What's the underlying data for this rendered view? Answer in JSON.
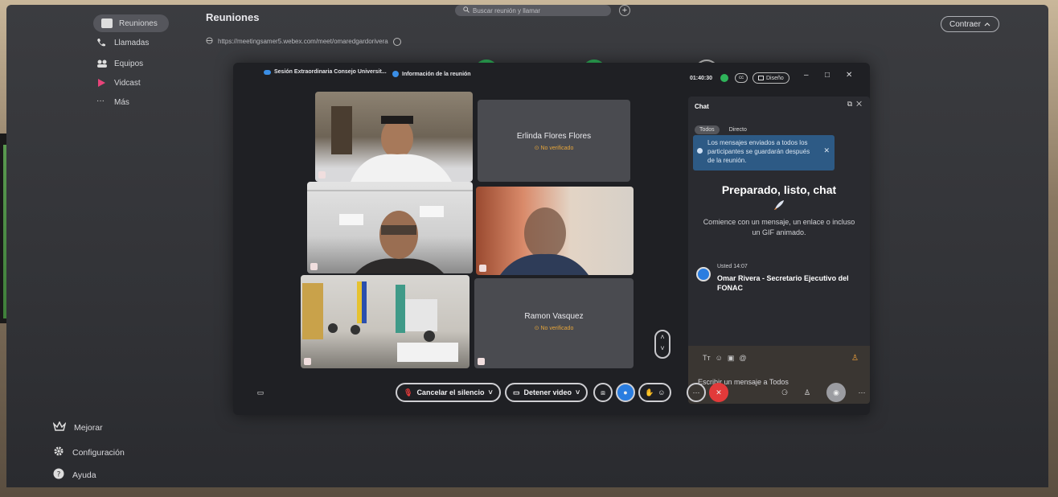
{
  "sidebar": {
    "items": [
      {
        "label": "Reuniones",
        "icon": "calendar-icon",
        "active": true
      },
      {
        "label": "Llamadas",
        "icon": "phone-icon"
      },
      {
        "label": "Equipos",
        "icon": "team-icon"
      },
      {
        "label": "Vidcast",
        "icon": "vidcast-icon"
      },
      {
        "label": "Más",
        "icon": "more-icon"
      }
    ],
    "bottom": [
      {
        "label": "Mejorar",
        "icon": "crown-icon"
      },
      {
        "label": "Configuración",
        "icon": "gear-icon"
      },
      {
        "label": "Ayuda",
        "icon": "help-icon"
      }
    ]
  },
  "header": {
    "title": "Reuniones",
    "meeting_url": "https://meetingsamer5.webex.com/meet/omaredgardorivera",
    "search_placeholder": "Buscar reunión y llamar",
    "collapse_label": "Contraer"
  },
  "meeting": {
    "title": "Sesión Extraordinaria Consejo Universit...",
    "info_label": "Información de la reunión",
    "timer": "01:40:30",
    "layout_label": "Diseño",
    "participants": [
      {
        "name": "Erlinda Flores Flores",
        "status": "No verificado"
      },
      {
        "name": "Ramon Vasquez",
        "status": "No verificado"
      }
    ]
  },
  "chat": {
    "title": "Chat",
    "tabs": [
      "Todos",
      "Directo"
    ],
    "notice": "Los mensajes enviados a todos los participantes se guardarán después de la reunión.",
    "empty_title": "Preparado, listo, chat",
    "empty_sub": "Comience con un mensaje, un enlace o incluso un GIF animado.",
    "message_meta": "Usted  14:07",
    "message_text": "Omar Rivera - Secretario Ejecutivo del FONAC",
    "input_placeholder": "Escribir un mensaje a Todos"
  },
  "toolbar": {
    "mute_label": "Cancelar el silencio",
    "video_label": "Detener video"
  },
  "colors": {
    "accent_green": "#2fb45a",
    "end_red": "#e23a3a",
    "unverified_orange": "#e6a53a",
    "notice_blue": "#2d5a85"
  }
}
